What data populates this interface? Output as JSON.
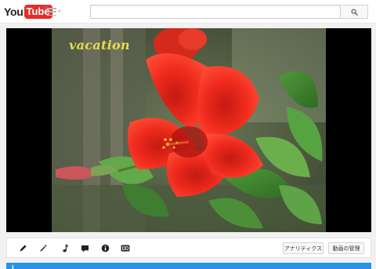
{
  "header": {
    "logo_you": "You",
    "logo_tube": "Tube",
    "logo_region": "JP",
    "search": {
      "value": "",
      "placeholder": ""
    }
  },
  "video": {
    "caption": "vacation"
  },
  "toolbar": {
    "tools": [
      {
        "name": "edit",
        "icon": "pencil-icon"
      },
      {
        "name": "enhancements",
        "icon": "magic-wand-icon"
      },
      {
        "name": "audio",
        "icon": "music-note-icon"
      },
      {
        "name": "annotations",
        "icon": "speech-bubble-icon"
      },
      {
        "name": "info",
        "icon": "info-icon"
      },
      {
        "name": "subtitles",
        "icon": "cc-icon"
      }
    ],
    "analytics_label": "アナリティクス",
    "video_manager_label": "動画の管理"
  },
  "notice": {
    "text": "",
    "link": ""
  },
  "colors": {
    "brand_red": "#e52d27",
    "notice_blue": "#2793e6",
    "caption_yellow": "#e6dd4c"
  }
}
